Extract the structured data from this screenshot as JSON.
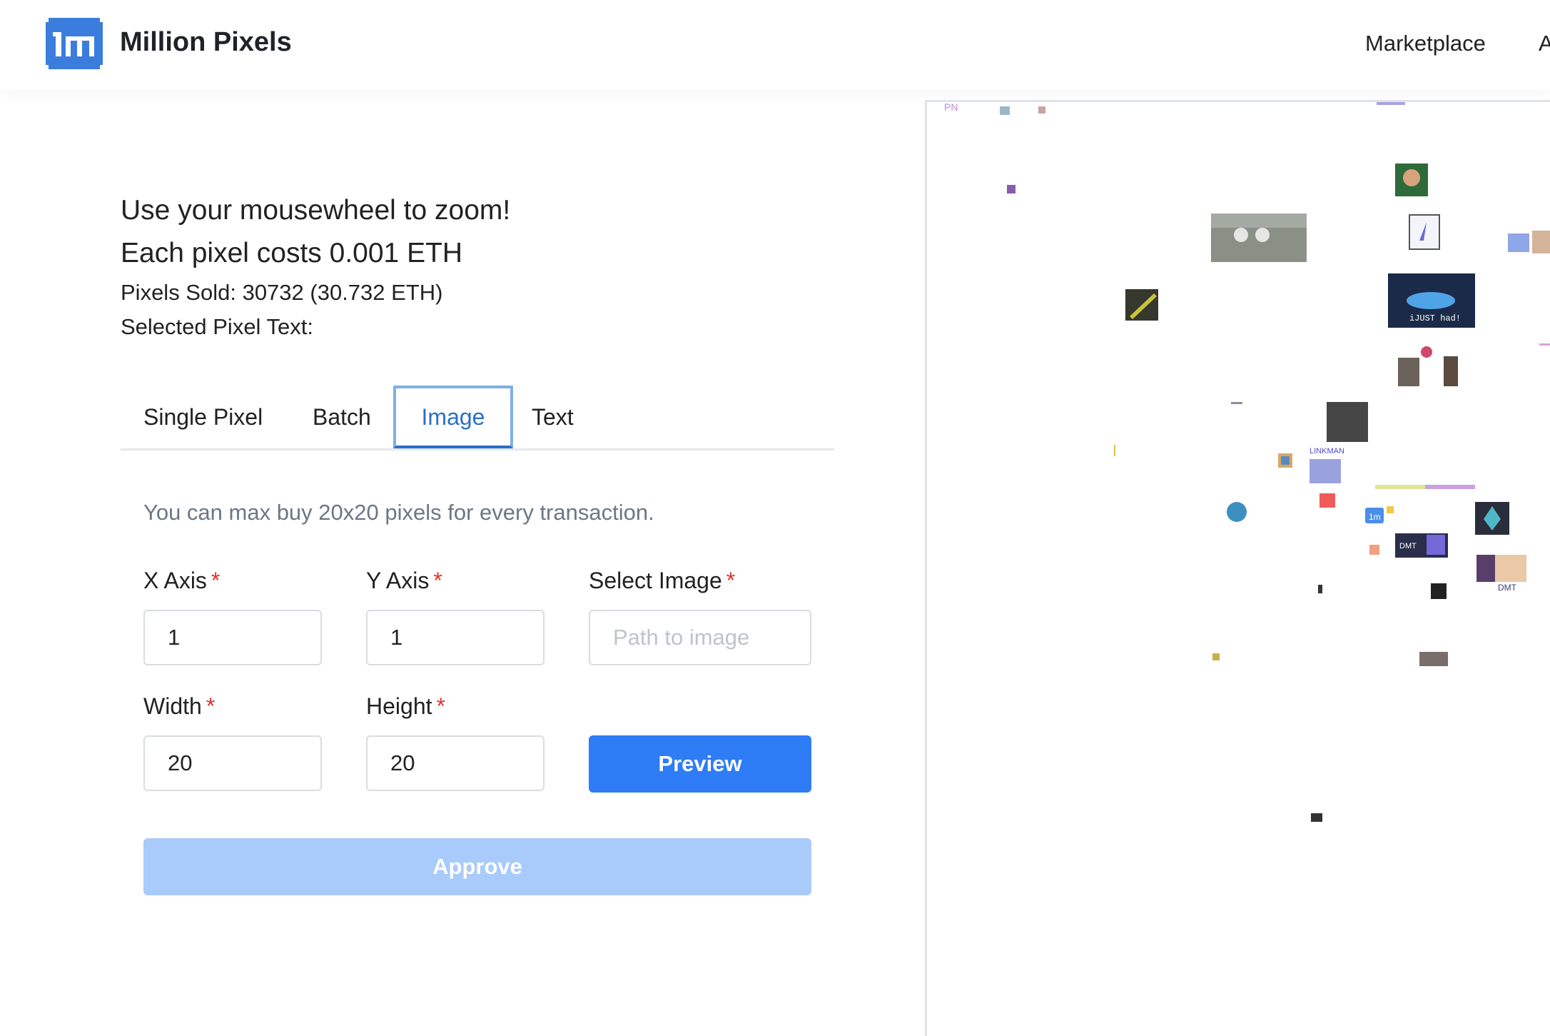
{
  "header": {
    "brand": "Million Pixels",
    "nav": [
      "Marketplace",
      "A"
    ]
  },
  "info": {
    "zoom_hint": "Use your mousewheel to zoom!",
    "price": "Each pixel costs 0.001 ETH",
    "sold": "Pixels Sold: 30732 (30.732 ETH)",
    "selected_text": "Selected Pixel Text:"
  },
  "tabs": [
    {
      "label": "Single Pixel",
      "active": false
    },
    {
      "label": "Batch",
      "active": false
    },
    {
      "label": "Image",
      "active": true
    },
    {
      "label": "Text",
      "active": false
    }
  ],
  "form": {
    "hint": "You can max buy 20x20 pixels for every transaction.",
    "x_label": "X Axis",
    "x_value": "1",
    "y_label": "Y Axis",
    "y_value": "1",
    "image_label": "Select Image",
    "image_placeholder": "Path to image",
    "width_label": "Width",
    "width_value": "20",
    "height_label": "Height",
    "height_value": "20",
    "required_mark": "*",
    "preview_label": "Preview",
    "approve_label": "Approve"
  },
  "canvas": {
    "texts": [
      "PN",
      "LINKMAN",
      "DMT",
      "1m",
      "iJUST had!",
      "DMT"
    ]
  },
  "colors": {
    "primary": "#2e7cf6",
    "primary_disabled": "#a9cbfb",
    "tab_active": "#2a6fc9",
    "required": "#e0342f"
  }
}
